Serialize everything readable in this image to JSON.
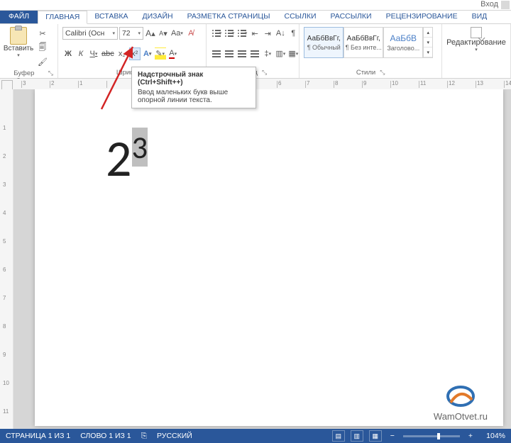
{
  "window": {
    "login": "Вход"
  },
  "tabs": {
    "file": "ФАЙЛ",
    "home": "ГЛАВНАЯ",
    "insert": "ВСТАВКА",
    "design": "ДИЗАЙН",
    "layout": "РАЗМЕТКА СТРАНИЦЫ",
    "refs": "ССЫЛКИ",
    "mail": "РАССЫЛКИ",
    "review": "РЕЦЕНЗИРОВАНИЕ",
    "view": "ВИД"
  },
  "ribbon": {
    "clipboard_group": "Буфер обмена",
    "clipboard_paste": "Вставить",
    "font_group": "Шрифт",
    "paragraph_group": "Абзац",
    "styles_group": "Стили",
    "editing_group": "Редактирование",
    "launcher": "⤡"
  },
  "font": {
    "name": "Calibri (Осн",
    "size": "72",
    "bold": "Ж",
    "italic": "К",
    "underline": "Ч",
    "strike": "abc",
    "sub": "x₂",
    "sup": "x²",
    "clear": "Aa",
    "grow": "A",
    "shrink": "A",
    "textfx": "A",
    "highlight": "✎",
    "color": "A",
    "case": "Aa"
  },
  "styles": {
    "sample": "АаБбВвГг,",
    "sample_h": "АаБбВ",
    "s1": "¶ Обычный",
    "s2": "¶ Без инте...",
    "s3": "Заголово..."
  },
  "tooltip": {
    "title": "Надстрочный знак (Ctrl+Shift++)",
    "body": "Ввод маленьких букв выше опорной линии текста."
  },
  "document": {
    "base": "2",
    "exp": "3"
  },
  "watermark": "WamOtvet.ru",
  "status": {
    "page": "СТРАНИЦА 1 ИЗ 1",
    "words": "СЛОВО 1 ИЗ 1",
    "lang_icon": "⎘",
    "lang": "РУССКИЙ",
    "zoom": "104%",
    "plus": "+",
    "minus": "−"
  }
}
